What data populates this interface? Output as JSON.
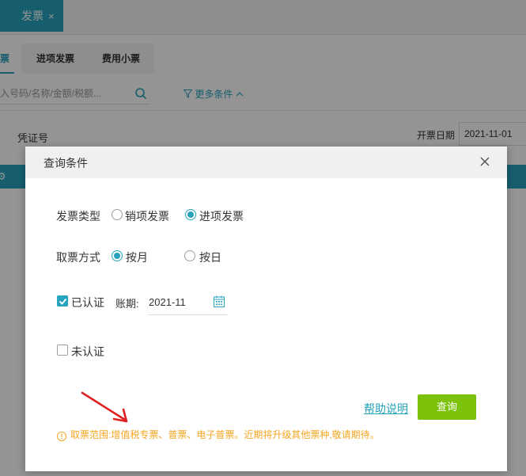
{
  "topbar": {
    "tab_label": "发票",
    "tab_close": "×"
  },
  "subtabs": [
    "票",
    "进项发票",
    "费用小票"
  ],
  "search": {
    "placeholder": "入号码/名称/金额/税额...",
    "more_conditions": "更多条件"
  },
  "table_header": {
    "col_voucher": "凭证号",
    "col_date_label": "开票日期",
    "col_date_value": "2021-11-01"
  },
  "dialog": {
    "title": "查询条件",
    "invoice_type": {
      "label": "发票类型",
      "options": [
        "销项发票",
        "进项发票"
      ],
      "selected": "进项发票"
    },
    "fetch_method": {
      "label": "取票方式",
      "options": [
        "按月",
        "按日"
      ],
      "selected": "按月"
    },
    "verified": {
      "label": "已认证",
      "checked": true,
      "period_label": "账期:",
      "period_value": "2021-11"
    },
    "unverified": {
      "label": "未认证",
      "checked": false
    },
    "help_link": "帮助说明",
    "query_button": "查询",
    "note_prefix": "取票范围:",
    "note_text": "增值税专票、普票、电子普票。近期将升级其他票种,敬请期待。"
  },
  "colors": {
    "accent": "#26a3bd",
    "button": "#7cc20a",
    "note": "#f5a623",
    "annotation_arrow": "#e02020"
  }
}
